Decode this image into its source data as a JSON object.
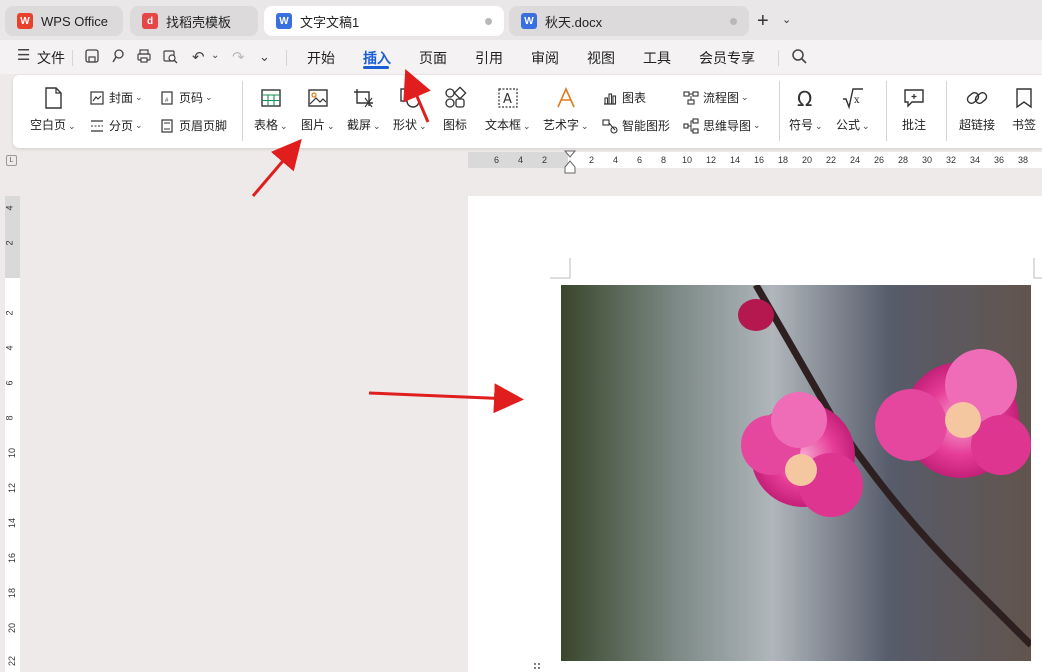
{
  "tabs": [
    {
      "label": "WPS Office",
      "icon": "wps-logo-icon",
      "color": "#e8412c"
    },
    {
      "label": "找稻壳模板",
      "icon": "docer-icon",
      "color": "#e54646"
    },
    {
      "label": "文字文稿1",
      "icon": "word-doc-icon",
      "color": "#3a6fe0"
    },
    {
      "label": "秋天.docx",
      "icon": "word-doc-icon",
      "color": "#3a6fe0"
    }
  ],
  "menu": {
    "file": "文件",
    "items": [
      "开始",
      "插入",
      "页面",
      "引用",
      "审阅",
      "视图",
      "工具",
      "会员专享"
    ],
    "active": "插入"
  },
  "ribbon": {
    "blank_page": "空白页",
    "cover": "封面",
    "page_number": "页码",
    "page_break": "分页",
    "header_footer": "页眉页脚",
    "table": "表格",
    "picture": "图片",
    "screenshot": "截屏",
    "shape": "形状",
    "icon": "图标",
    "textbox": "文本框",
    "wordart": "艺术字",
    "chart": "图表",
    "smart_art": "智能图形",
    "flowchart": "流程图",
    "mindmap": "思维导图",
    "symbol": "符号",
    "formula": "公式",
    "comment": "批注",
    "hyperlink": "超链接",
    "bookmark": "书签"
  },
  "ruler": {
    "h_ticks": [
      "6",
      "4",
      "2",
      "2",
      "4",
      "6",
      "8",
      "10",
      "12",
      "14",
      "16",
      "18",
      "20",
      "22",
      "24",
      "26",
      "28",
      "30",
      "32",
      "34",
      "36",
      "38"
    ],
    "v_ticks": [
      "4",
      "2",
      "2",
      "4",
      "6",
      "8",
      "10",
      "12",
      "14",
      "16",
      "18",
      "20",
      "22"
    ]
  },
  "colors": {
    "accent": "#1b5fd6",
    "annotation_arrow": "#e01e1e",
    "blossom": "#e0318f"
  }
}
